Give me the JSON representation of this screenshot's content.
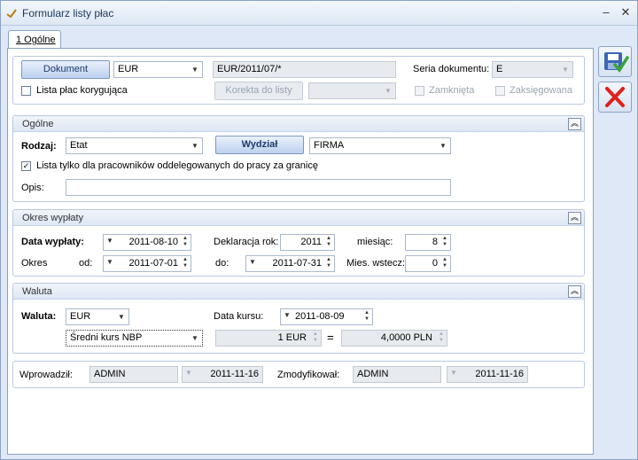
{
  "window": {
    "title": "Formularz listy płac",
    "minimize": "–",
    "close": "✕"
  },
  "tab": {
    "label": "1 Ogólne"
  },
  "header": {
    "dokument_button": "Dokument",
    "currency": "EUR",
    "document_number": "EUR/2011/07/*",
    "seria_label": "Seria dokumentu:",
    "seria_value": "E",
    "lista_korygujaca_label": "Lista płac korygująca",
    "korekta_button": "Korekta do listy",
    "zamknieta_label": "Zamknięta",
    "zaksiegowana_label": "Zaksięgowana"
  },
  "ogolne": {
    "title": "Ogólne",
    "rodzaj_label": "Rodzaj:",
    "rodzaj_value": "Etat",
    "wydzial_button": "Wydział",
    "wydzial_value": "FIRMA",
    "oddelegowani_label": "Lista tylko dla pracowników oddelegowanych do pracy za granicę",
    "opis_label": "Opis:",
    "opis_value": ""
  },
  "okres": {
    "title": "Okres wypłaty",
    "data_wyplaty_label": "Data wypłaty:",
    "data_wyplaty": "2011-08-10",
    "deklaracja_label": "Deklaracja rok:",
    "deklaracja_rok": "2011",
    "miesiac_label": "miesiąc:",
    "miesiac": "8",
    "okres_label": "Okres",
    "od_label": "od:",
    "od": "2011-07-01",
    "do_label": "do:",
    "do": "2011-07-31",
    "mies_wstecz_label": "Mies. wstecz:",
    "mies_wstecz": "0"
  },
  "waluta": {
    "title": "Waluta",
    "waluta_label": "Waluta:",
    "waluta_value": "EUR",
    "data_kursu_label": "Data kursu:",
    "data_kursu": "2011-08-09",
    "kurs_type": "Średni kurs NBP",
    "amount_from": "1 EUR",
    "equals": "=",
    "amount_to": "4,0000 PLN"
  },
  "footer": {
    "wprowadzil_label": "Wprowadził:",
    "wprowadzil_user": "ADMIN",
    "wprowadzil_date": "2011-11-16",
    "zmodyfikowal_label": "Zmodyfikował:",
    "zmodyfikowal_user": "ADMIN",
    "zmodyfikowal_date": "2011-11-16"
  },
  "icons": {
    "save": "save-icon",
    "cancel": "cancel-icon"
  },
  "colors": {
    "accent": "#1e395b",
    "cancel_red": "#e0201a",
    "save_green": "#3aa43a"
  }
}
